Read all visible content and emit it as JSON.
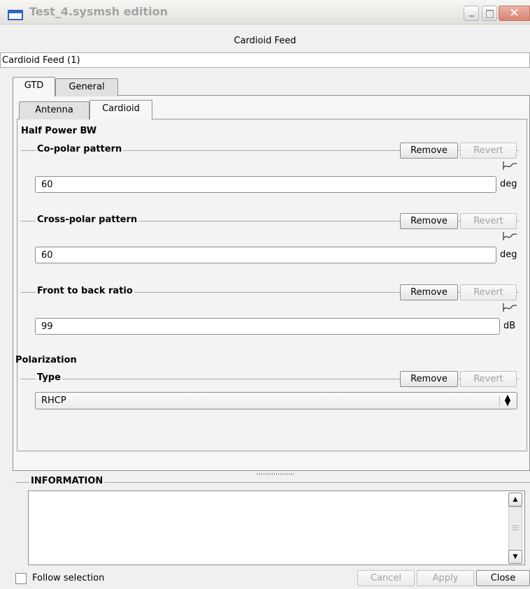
{
  "window": {
    "title": "Test_4.sysmsh edition"
  },
  "header": {
    "title": "Cardioid Feed",
    "name_value": "Cardioid Feed (1)"
  },
  "tabs": {
    "outer": [
      "GTD",
      "General"
    ],
    "inner": [
      "Antenna",
      "Cardioid"
    ]
  },
  "half_power_bw": {
    "title": "Half Power BW",
    "groups": [
      {
        "label": "Co-polar pattern",
        "value": "60",
        "unit": "deg",
        "remove": "Remove",
        "revert": "Revert"
      },
      {
        "label": "Cross-polar pattern",
        "value": "60",
        "unit": "deg",
        "remove": "Remove",
        "revert": "Revert"
      },
      {
        "label": "Front to back ratio",
        "value": "99",
        "unit": "dB",
        "remove": "Remove",
        "revert": "Revert"
      }
    ]
  },
  "polarization": {
    "title": "Polarization",
    "type": {
      "label": "Type",
      "selected": "RHCP",
      "remove": "Remove",
      "revert": "Revert"
    }
  },
  "information": {
    "title": "INFORMATION",
    "text": ""
  },
  "footer": {
    "follow_selection": "Follow selection",
    "cancel": "Cancel",
    "apply": "Apply",
    "close": "Close"
  },
  "colors": {
    "title_active_icon": "#2f63c7",
    "close_button": "#d98472",
    "dialog_bg": "#f0f0f0"
  }
}
